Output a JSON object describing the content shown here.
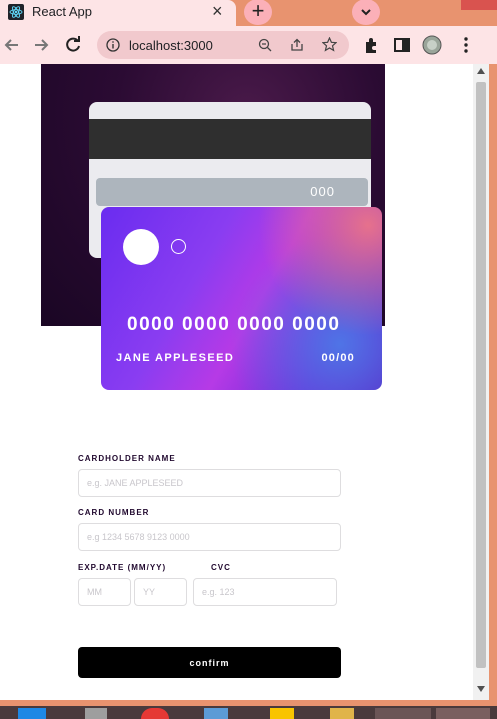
{
  "browser": {
    "tab_title": "React App",
    "tab_close": "×",
    "new_tab": "+",
    "url": "localhost:3000"
  },
  "card": {
    "back_cvc": "000",
    "number": "0000 0000 0000 0000",
    "holder": "JANE APPLESEED",
    "expiry": "00/00"
  },
  "form": {
    "cardholder_label": "CARDHOLDER NAME",
    "cardholder_placeholder": "e.g. JANE APPLESEED",
    "number_label": "CARD NUMBER",
    "number_placeholder": "e.g 1234 5678 9123 0000",
    "exp_label": "EXP.DATE (MM/YY)",
    "mm_placeholder": "MM",
    "yy_placeholder": "YY",
    "cvc_label": "CVC",
    "cvc_placeholder": "e.g. 123",
    "confirm_label": "confirm"
  },
  "colors": {
    "accent": "#6a2cf0",
    "dark": "#21092f"
  }
}
